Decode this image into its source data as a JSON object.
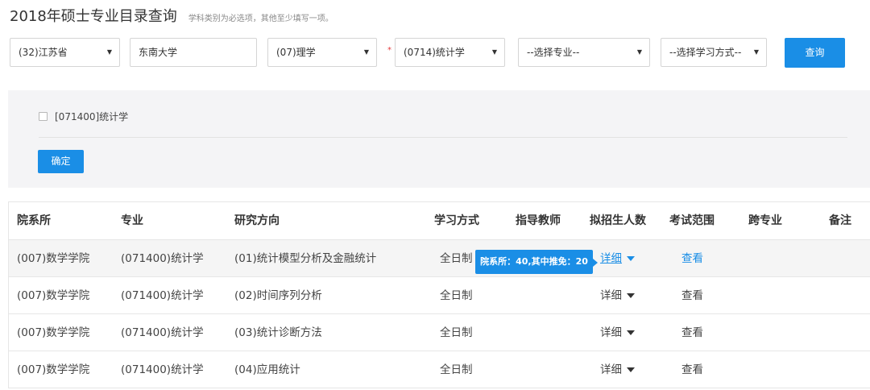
{
  "header": {
    "title": "2018年硕士专业目录查询",
    "subtitle": "学科类别为必选项，其他至少填写一项。"
  },
  "filters": {
    "province": "(32)江苏省",
    "school": "东南大学",
    "category": "(07)理学",
    "discipline": "(0714)统计学",
    "major": "--选择专业--",
    "study_mode": "--选择学习方式--",
    "required_mark": "*",
    "query_label": "查询"
  },
  "panel": {
    "option_label": "[071400]统计学",
    "confirm_label": "确定"
  },
  "table": {
    "headers": [
      "院系所",
      "专业",
      "研究方向",
      "学习方式",
      "指导教师",
      "拟招生人数",
      "考试范围",
      "跨专业",
      "备注"
    ],
    "rows": [
      {
        "dept": "(007)数学学院",
        "major": "(071400)统计学",
        "direction": "(01)统计模型分析及金融统计",
        "mode": "全日制",
        "advisor": "",
        "quota": "详细",
        "exam": "查看",
        "cross": "",
        "note": ""
      },
      {
        "dept": "(007)数学学院",
        "major": "(071400)统计学",
        "direction": "(02)时间序列分析",
        "mode": "全日制",
        "advisor": "",
        "quota": "详细",
        "exam": "查看",
        "cross": "",
        "note": ""
      },
      {
        "dept": "(007)数学学院",
        "major": "(071400)统计学",
        "direction": "(03)统计诊断方法",
        "mode": "全日制",
        "advisor": "",
        "quota": "详细",
        "exam": "查看",
        "cross": "",
        "note": ""
      },
      {
        "dept": "(007)数学学院",
        "major": "(071400)统计学",
        "direction": "(04)应用统计",
        "mode": "全日制",
        "advisor": "",
        "quota": "详细",
        "exam": "查看",
        "cross": "",
        "note": ""
      }
    ]
  },
  "tooltip": {
    "text": "院系所：40,其中推免：20"
  },
  "colors": {
    "accent": "#1a8ee6",
    "required": "#e4393c"
  },
  "icons": {
    "dropdown": "caret-down-icon",
    "quota_toggle": "caret-down-icon"
  }
}
